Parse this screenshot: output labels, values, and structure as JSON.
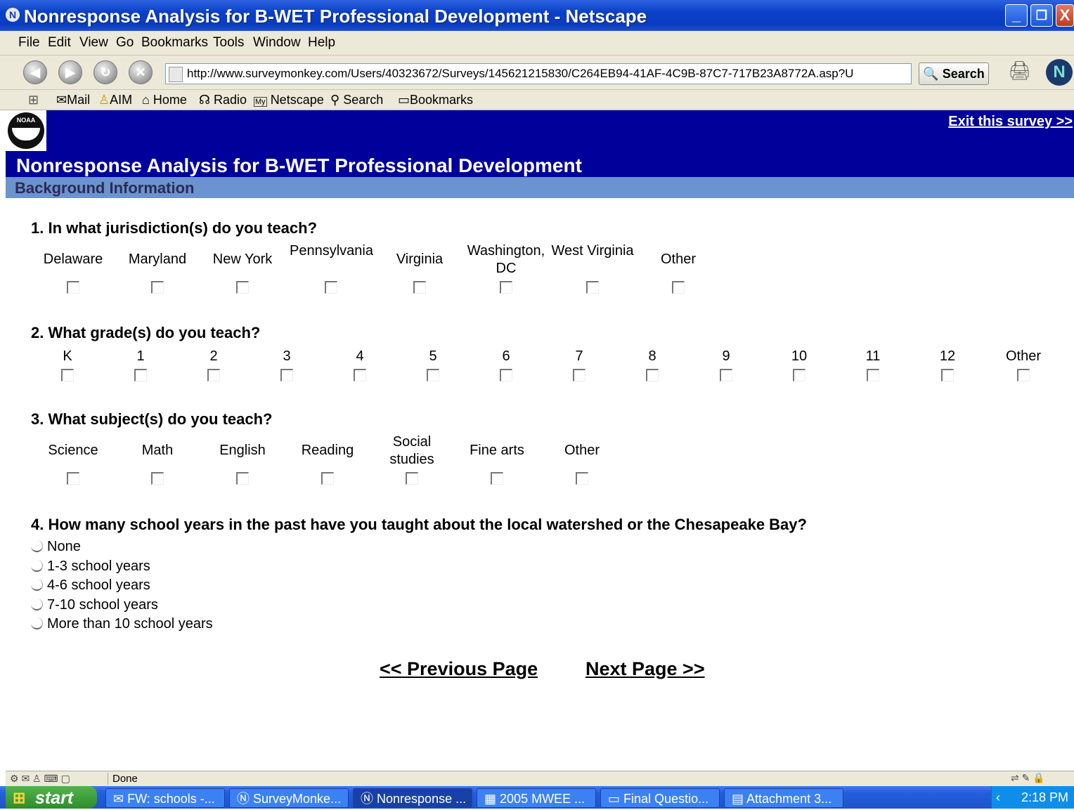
{
  "window": {
    "title": "Nonresponse Analysis for B-WET Professional Development - Netscape",
    "app_icon": "N",
    "controls": [
      "_",
      "❐",
      "X"
    ]
  },
  "menubar": [
    "File",
    "Edit",
    "View",
    "Go",
    "Bookmarks",
    "Tools",
    "Window",
    "Help"
  ],
  "navbar": {
    "url": "http://www.surveymonkey.com/Users/40323672/Surveys/145621215830/C264EB94-41AF-4C9B-87C7-717B23A8772A.asp?U",
    "search_label": "Search",
    "netscape_logo": "N"
  },
  "personal_toolbar": [
    "Mail",
    "AIM",
    "Home",
    "Radio",
    "Netscape",
    "Search",
    "Bookmarks"
  ],
  "survey": {
    "logo_text": "NOAA",
    "exit_link": "Exit this survey >>",
    "title": "Nonresponse Analysis for B-WET Professional Development",
    "section": "Background Information",
    "q1": {
      "text": "1. In what jurisdiction(s) do you teach?",
      "options": [
        "Delaware",
        "Maryland",
        "New York",
        "Pennsylvania",
        "Virginia",
        "Washington, DC",
        "West Virginia",
        "Other"
      ]
    },
    "q2": {
      "text": "2. What grade(s) do you teach?",
      "options": [
        "K",
        "1",
        "2",
        "3",
        "4",
        "5",
        "6",
        "7",
        "8",
        "9",
        "10",
        "11",
        "12",
        "Other"
      ]
    },
    "q3": {
      "text": "3. What subject(s) do you teach?",
      "options": [
        "Science",
        "Math",
        "English",
        "Reading",
        "Social studies",
        "Fine arts",
        "Other"
      ]
    },
    "q4": {
      "text": "4. How many school years in the past have you taught about the local watershed or the Chesapeake Bay?",
      "options": [
        "None",
        "1-3 school years",
        "4-6 school years",
        "7-10 school years",
        "More than 10 school years"
      ]
    },
    "prev_link": "<< Previous Page",
    "next_link": "Next Page >>"
  },
  "status": {
    "text": "Done"
  },
  "taskbar": {
    "start_label": "start",
    "tasks": [
      "FW: schools -...",
      "SurveyMonke...",
      "Nonresponse ...",
      "2005 MWEE ...",
      "Final Questio...",
      "Attachment 3..."
    ],
    "active_task": "Nonresponse ...",
    "clock": "2:18 PM"
  },
  "colors": {
    "survey_header": "#02009b",
    "section_band": "#6b93cf",
    "xp_titlebar": "#0b3cbf",
    "chrome": "#ece9d8"
  }
}
